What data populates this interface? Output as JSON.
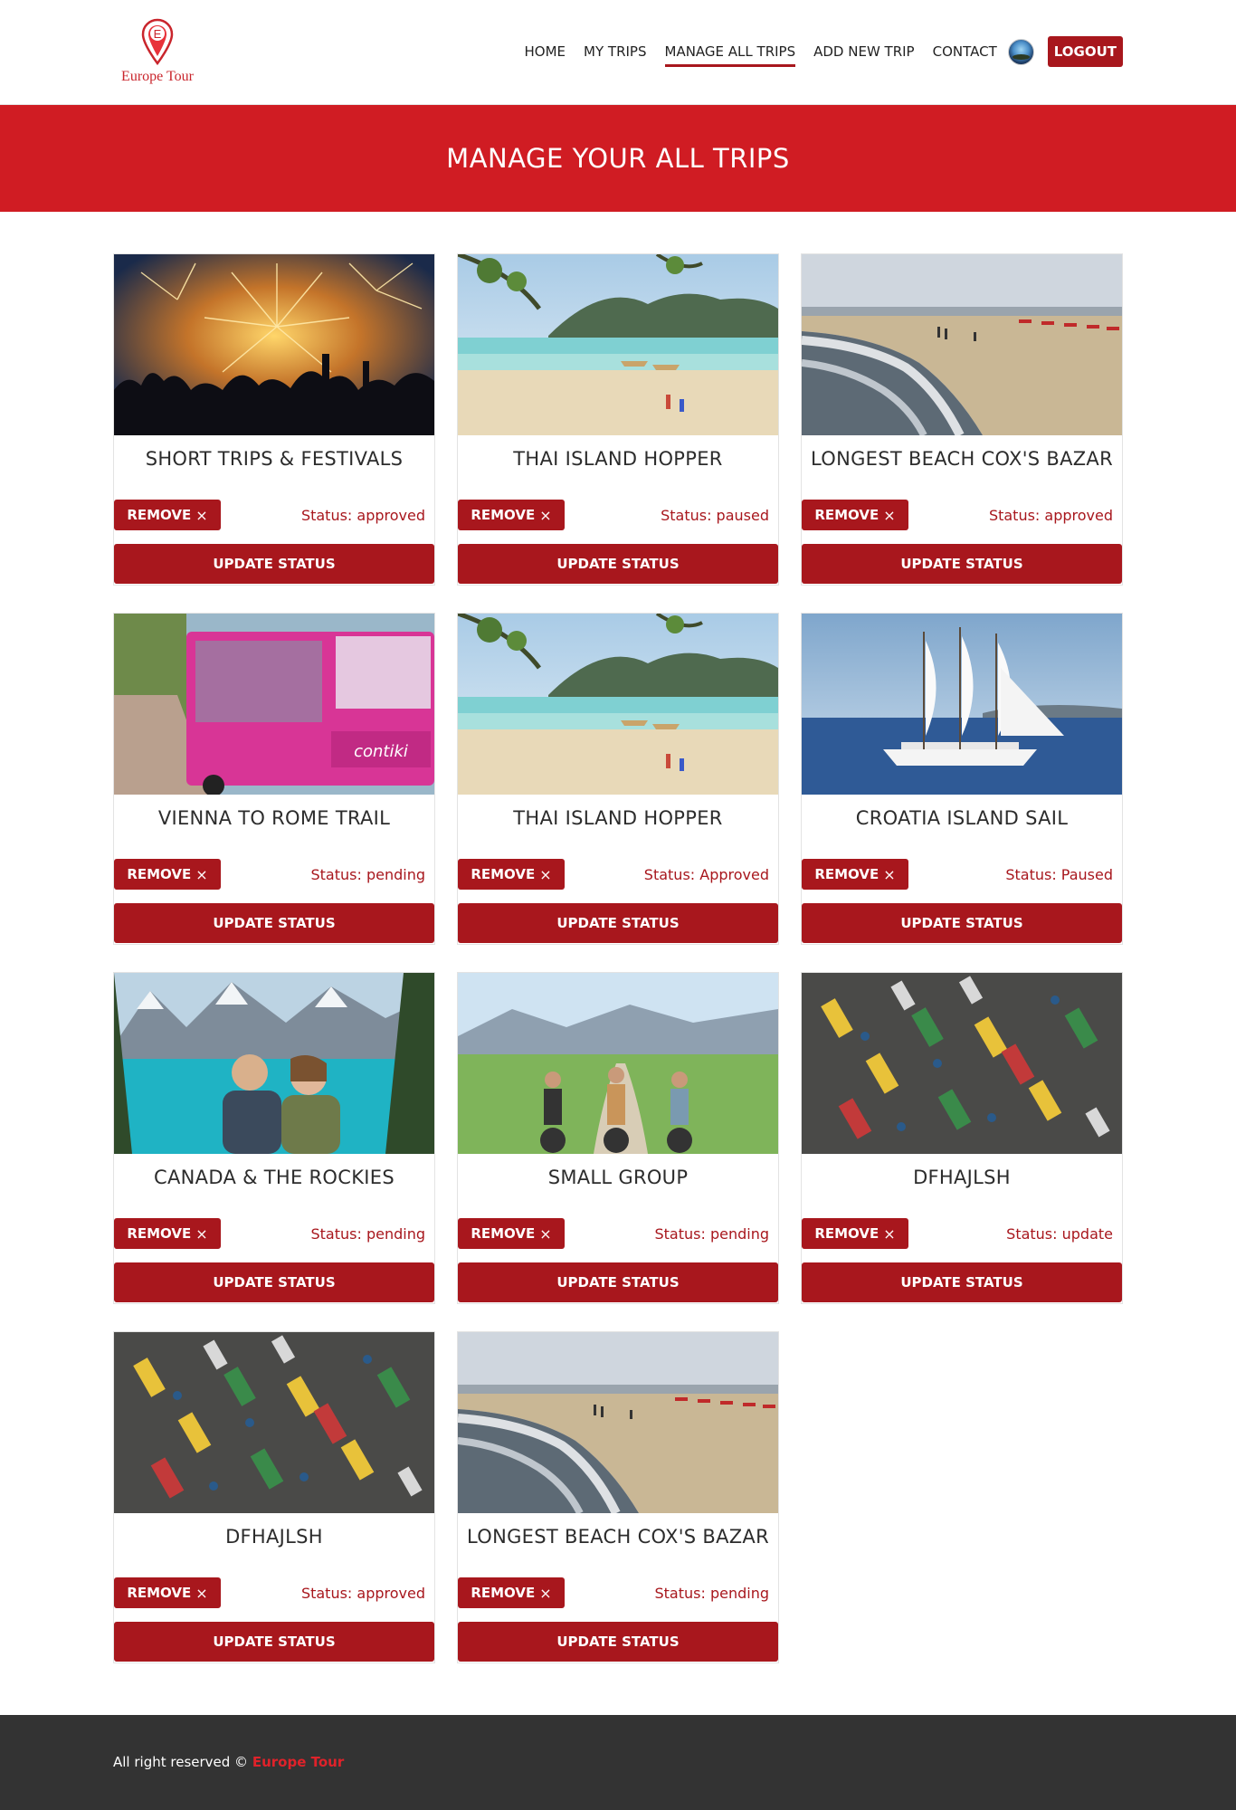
{
  "header": {
    "logo_letter": "E",
    "logo_text": "Europe Tour",
    "nav": [
      {
        "label": "HOME",
        "active": false
      },
      {
        "label": "MY TRIPS",
        "active": false
      },
      {
        "label": "MANAGE ALL TRIPS",
        "active": true
      },
      {
        "label": "ADD NEW TRIP",
        "active": false
      },
      {
        "label": "CONTACT",
        "active": false
      }
    ],
    "logout_label": "LOGOUT"
  },
  "hero": {
    "title": "MANAGE YOUR ALL TRIPS"
  },
  "cards": [
    {
      "title": "SHORT TRIPS & FESTIVALS",
      "status": "Status: approved",
      "image": "fireworks-crowd"
    },
    {
      "title": "THAI ISLAND HOPPER",
      "status": "Status: paused",
      "image": "tropical-beach-boats"
    },
    {
      "title": "LONGEST BEACH COX'S BAZAR",
      "status": "Status: approved",
      "image": "beach-shoreline"
    },
    {
      "title": "VIENNA TO ROME TRAIL",
      "status": "Status: pending",
      "image": "pink-tour-bus"
    },
    {
      "title": "THAI ISLAND HOPPER",
      "status": "Status: Approved",
      "image": "tropical-beach-boats"
    },
    {
      "title": "CROATIA ISLAND SAIL",
      "status": "Status: Paused",
      "image": "sailing-ship"
    },
    {
      "title": "CANADA & THE ROCKIES",
      "status": "Status: pending",
      "image": "mountain-lake-friends"
    },
    {
      "title": "SMALL GROUP",
      "status": "Status: pending",
      "image": "cyclists-meadow"
    },
    {
      "title": "DFHAJLSH",
      "status": "Status: update",
      "image": "city-traffic"
    },
    {
      "title": "DFHAJLSH",
      "status": "Status: approved",
      "image": "city-traffic"
    },
    {
      "title": "LONGEST BEACH COX'S BAZAR",
      "status": "Status: pending",
      "image": "beach-shoreline"
    }
  ],
  "card_labels": {
    "remove": "REMOVE",
    "remove_icon": "×",
    "update": "UPDATE STATUS"
  },
  "footer": {
    "text": "All right reserved ©",
    "brand": "Europe Tour"
  },
  "colors": {
    "accent": "#a8171d",
    "hero_bg": "#d01c23",
    "footer_bg": "#333333",
    "footer_brand": "#e0222a"
  }
}
